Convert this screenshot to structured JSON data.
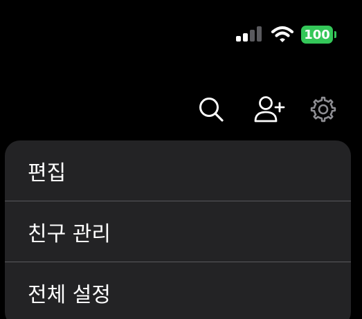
{
  "status_bar": {
    "battery_level": "100",
    "battery_color": "#34c759",
    "signal_bars_active": 2,
    "signal_bars_total": 4,
    "signal_active_color": "#ffffff",
    "signal_inactive_color": "#5a5a5e"
  },
  "toolbar": {
    "icons": [
      "search-icon",
      "add-friend-icon",
      "settings-icon"
    ],
    "icon_color": "#ffffff",
    "settings_icon_color": "#8e8e93"
  },
  "menu": {
    "background": "#232325",
    "items": [
      {
        "label": "편집"
      },
      {
        "label": "친구 관리"
      },
      {
        "label": "전체 설정"
      }
    ]
  }
}
